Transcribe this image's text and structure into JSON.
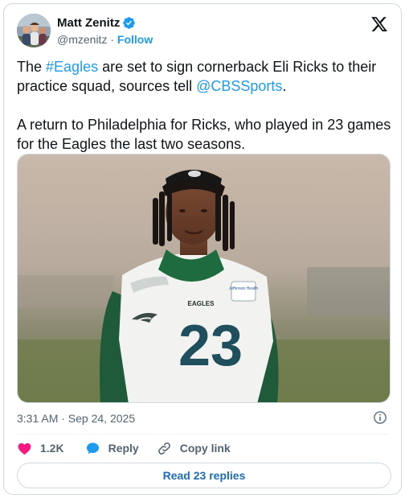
{
  "author": {
    "name": "Matt Zenitz",
    "handle": "@mzenitz",
    "separator": " · ",
    "follow_label": "Follow"
  },
  "tweet": {
    "p1_before": "The ",
    "p1_hashtag": "#Eagles",
    "p1_middle": " are set to sign cornerback Eli Ricks to their practice squad, sources tell ",
    "p1_mention": "@CBSSports",
    "p1_after": ".",
    "p2": "A return to Philadelphia for Ricks, who played in 23 games for the Eagles the last two seasons."
  },
  "photo": {
    "jersey_label": "EAGLES",
    "jersey_number": "23",
    "patch_text": "Jefferson Health"
  },
  "timestamp": "3:31 AM · Sep 24, 2025",
  "actions": {
    "likes_count": "1.2K",
    "reply_label": "Reply",
    "copy_link_label": "Copy link"
  },
  "read_replies_label": "Read 23 replies",
  "colors": {
    "accent": "#1d9bf0",
    "heart": "#f91880",
    "text_secondary": "#536471",
    "border": "#cfd9de"
  },
  "icons": [
    "verified-badge-icon",
    "x-logo-icon",
    "info-icon",
    "heart-icon",
    "reply-bubble-icon",
    "link-icon"
  ]
}
